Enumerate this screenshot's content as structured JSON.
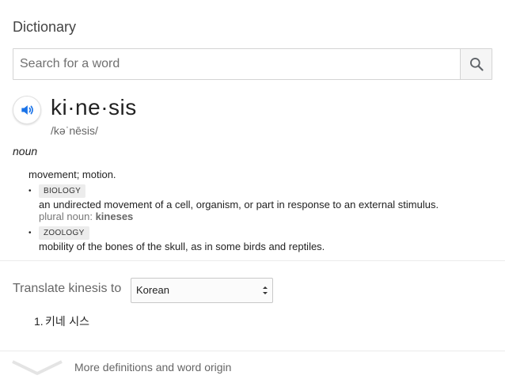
{
  "header": {
    "title": "Dictionary"
  },
  "search": {
    "placeholder": "Search for a word",
    "value": "",
    "icon": "search-icon"
  },
  "entry": {
    "speaker_icon": "speaker-icon",
    "headword": "ki·ne·sis",
    "phonetic": "/kəˈnēsis/",
    "part_of_speech": "noun",
    "main_definition": "movement; motion.",
    "senses": [
      {
        "tag": "BIOLOGY",
        "text": "an undirected movement of a cell, organism, or part in response to an external stimulus.",
        "plural_label": "plural noun:",
        "plural_value": "kineses"
      },
      {
        "tag": "ZOOLOGY",
        "text": "mobility of the bones of the skull, as in some birds and reptiles."
      }
    ]
  },
  "translate": {
    "label": "Translate kinesis to",
    "selected_language": "Korean",
    "results": [
      {
        "number": "1.",
        "text": "키네 시스"
      }
    ]
  },
  "footer": {
    "more_label": "More definitions and word origin",
    "icon": "chevron-down-icon"
  },
  "colors": {
    "accent_blue": "#1a73e8",
    "tag_bg": "#ececec",
    "divider": "#ebebeb"
  }
}
